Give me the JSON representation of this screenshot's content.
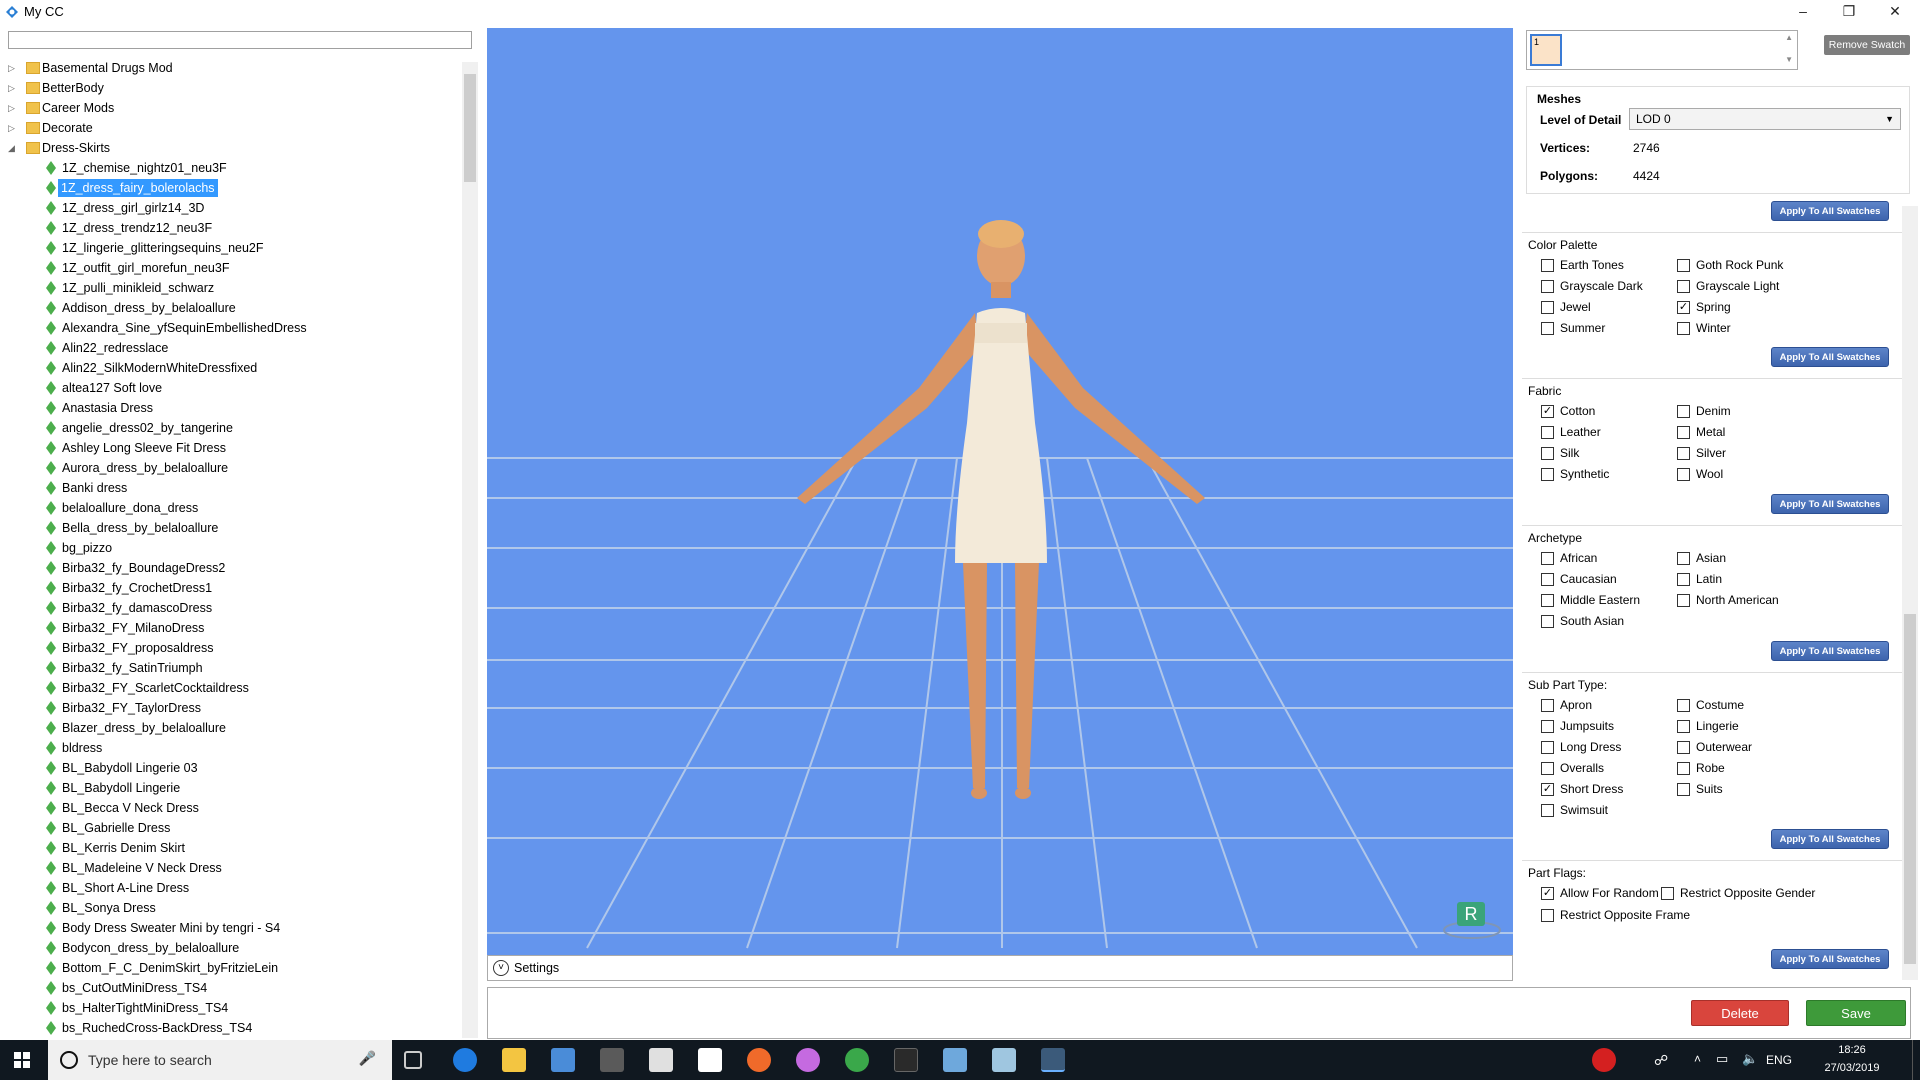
{
  "window": {
    "title": "My CC",
    "min": "–",
    "max": "❐",
    "close": "✕"
  },
  "tree": {
    "search_value": "",
    "folders_top": [
      "Basemental Drugs Mod",
      "BetterBody",
      "Career Mods",
      "Decorate"
    ],
    "open_folder": "Dress-Skirts",
    "items": [
      "1Z_chemise_nightz01_neu3F",
      "1Z_dress_fairy_bolerolachs",
      "1Z_dress_girl_girlz14_3D",
      "1Z_dress_trendz12_neu3F",
      "1Z_lingerie_glitteringsequins_neu2F",
      "1Z_outfit_girl_morefun_neu3F",
      "1Z_pulli_minikleid_schwarz",
      "Addison_dress_by_belaloallure",
      "Alexandra_Sine_yfSequinEmbellishedDress",
      "Alin22_redresslace",
      "Alin22_SilkModernWhiteDressfixed",
      "altea127 Soft love",
      "Anastasia Dress",
      "angelie_dress02_by_tangerine",
      "Ashley Long Sleeve Fit Dress",
      "Aurora_dress_by_belaloallure",
      "Banki dress",
      "belaloallure_dona_dress",
      "Bella_dress_by_belaloallure",
      "bg_pizzo",
      "Birba32_fy_BoundageDress2",
      "Birba32_fy_CrochetDress1",
      "Birba32_fy_damascoDress",
      "Birba32_FY_MilanoDress",
      "Birba32_FY_proposaldress",
      "Birba32_fy_SatinTriumph",
      "Birba32_FY_ScarletCocktaildress",
      "Birba32_FY_TaylorDress",
      "Blazer_dress_by_belaloallure",
      "bldress",
      "BL_Babydoll Lingerie 03",
      "BL_Babydoll Lingerie",
      "BL_Becca V Neck Dress",
      "BL_Gabrielle Dress",
      "BL_Kerris Denim Skirt",
      "BL_Madeleine V Neck Dress",
      "BL_Short A-Line Dress",
      "BL_Sonya Dress",
      "Body Dress Sweater Mini by tengri - S4",
      "Bodycon_dress_by_belaloallure",
      "Bottom_F_C_DenimSkirt_byFritzieLein",
      "bs_CutOutMiniDress_TS4",
      "bs_HalterTightMiniDress_TS4",
      "bs_RuchedCross-BackDress_TS4"
    ],
    "selected_index": 1
  },
  "viewport": {
    "settings_label": "Settings",
    "badge": "R",
    "bg_color": "#6495ed"
  },
  "swatch": {
    "value": "1",
    "remove_label": "Remove Swatch"
  },
  "meshes": {
    "title": "Meshes",
    "lod_label": "Level of Detail",
    "lod_value": "LOD 0",
    "vertices_label": "Vertices:",
    "vertices": "2746",
    "polygons_label": "Polygons:",
    "polygons": "4424"
  },
  "apply_label": "Apply To All Swatches",
  "color_palette": {
    "title": "Color Palette",
    "options": [
      {
        "label": "Earth Tones",
        "checked": false
      },
      {
        "label": "Goth Rock Punk",
        "checked": false
      },
      {
        "label": "Grayscale Dark",
        "checked": false
      },
      {
        "label": "Grayscale Light",
        "checked": false
      },
      {
        "label": "Jewel",
        "checked": false
      },
      {
        "label": "Spring",
        "checked": true
      },
      {
        "label": "Summer",
        "checked": false
      },
      {
        "label": "Winter",
        "checked": false
      }
    ]
  },
  "fabric": {
    "title": "Fabric",
    "options": [
      {
        "label": "Cotton",
        "checked": true
      },
      {
        "label": "Denim",
        "checked": false
      },
      {
        "label": "Leather",
        "checked": false
      },
      {
        "label": "Metal",
        "checked": false
      },
      {
        "label": "Silk",
        "checked": false
      },
      {
        "label": "Silver",
        "checked": false
      },
      {
        "label": "Synthetic",
        "checked": false
      },
      {
        "label": "Wool",
        "checked": false
      }
    ]
  },
  "archetype": {
    "title": "Archetype",
    "options": [
      {
        "label": "African",
        "checked": false
      },
      {
        "label": "Asian",
        "checked": false
      },
      {
        "label": "Caucasian",
        "checked": false
      },
      {
        "label": "Latin",
        "checked": false
      },
      {
        "label": "Middle Eastern",
        "checked": false
      },
      {
        "label": "North American",
        "checked": false
      },
      {
        "label": "South Asian",
        "checked": false
      }
    ]
  },
  "sub_part_type": {
    "title": "Sub Part Type:",
    "options": [
      {
        "label": "Apron",
        "checked": false
      },
      {
        "label": "Costume",
        "checked": false
      },
      {
        "label": "Jumpsuits",
        "checked": false
      },
      {
        "label": "Lingerie",
        "checked": false
      },
      {
        "label": "Long Dress",
        "checked": false
      },
      {
        "label": "Outerwear",
        "checked": false
      },
      {
        "label": "Overalls",
        "checked": false
      },
      {
        "label": "Robe",
        "checked": false
      },
      {
        "label": "Short Dress",
        "checked": true
      },
      {
        "label": "Suits",
        "checked": false
      },
      {
        "label": "Swimsuit",
        "checked": false
      }
    ]
  },
  "part_flags": {
    "title": "Part Flags:",
    "options": [
      {
        "label": "Allow For Random",
        "checked": true
      },
      {
        "label": "Restrict Opposite Gender",
        "checked": false
      },
      {
        "label": "Restrict Opposite Frame",
        "checked": false
      }
    ]
  },
  "actions": {
    "delete_label": "Delete",
    "save_label": "Save",
    "delete_color": "#d9453d",
    "save_color": "#3e9a3a"
  },
  "taskbar": {
    "search_placeholder": "Type here to search",
    "language": "ENG",
    "time": "18:26",
    "date": "27/03/2019"
  }
}
